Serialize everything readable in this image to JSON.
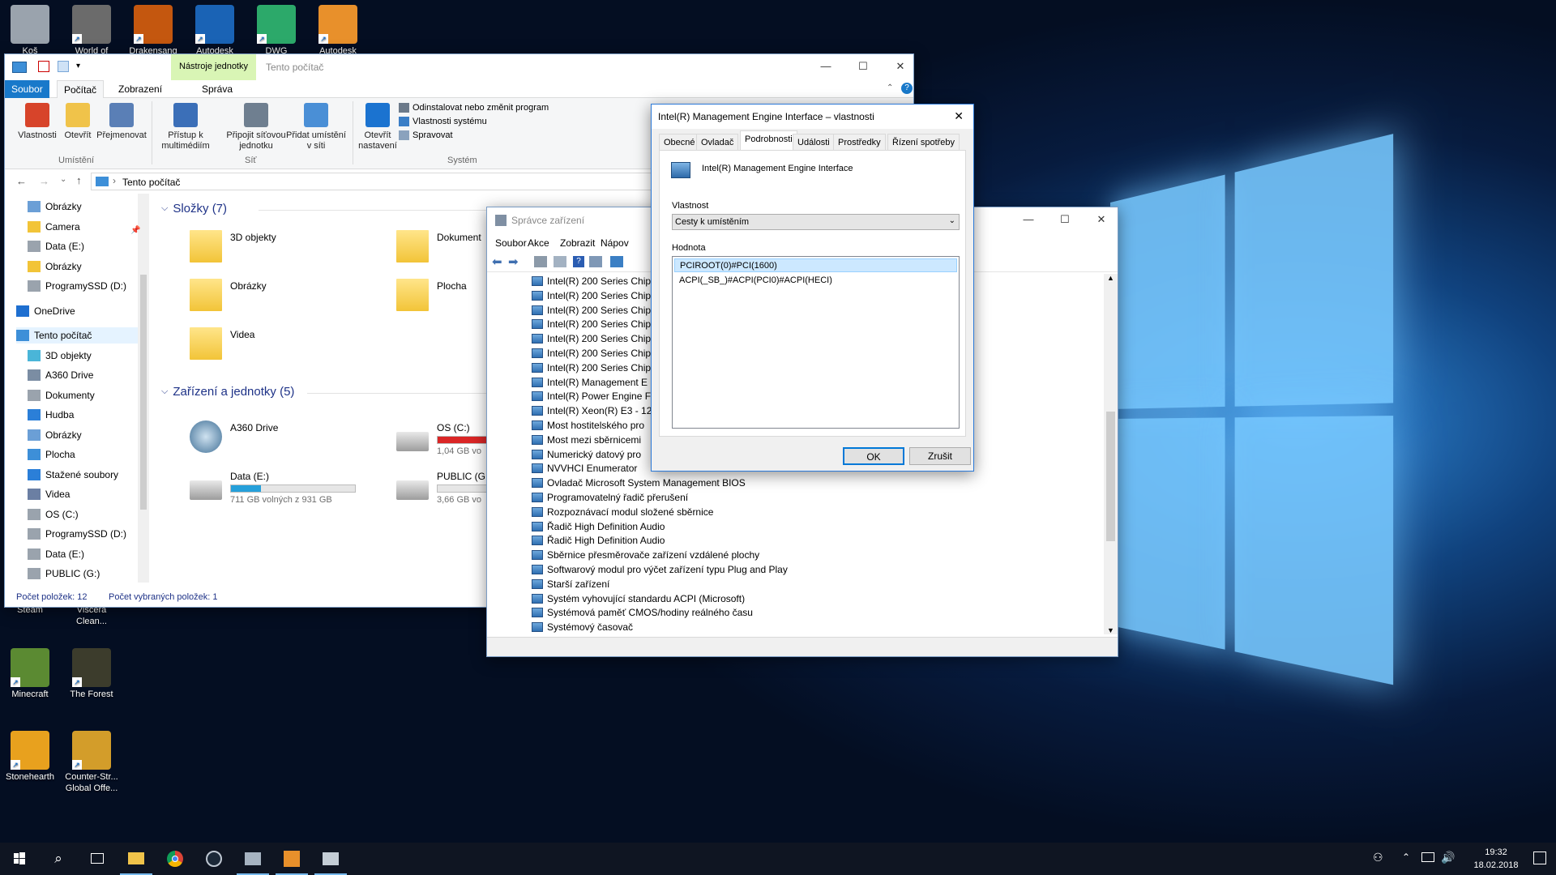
{
  "desktop": {
    "icons": [
      {
        "label": "Koš",
        "color": "#9aa3ad"
      },
      {
        "label": "World of",
        "color": "#6b6b6b"
      },
      {
        "label": "Drakensang",
        "color": "#c4570f"
      },
      {
        "label": "Autodesk",
        "color": "#1a63b5"
      },
      {
        "label": "DWG",
        "color": "#2ca96a"
      },
      {
        "label": "Autodesk",
        "color": "#e8902b"
      },
      {
        "label": "Steam",
        "color": "#1b2838"
      },
      {
        "label": "Viscera Clean...",
        "color": "#b44c2a"
      },
      {
        "label": "Minecraft",
        "color": "#5b8a32"
      },
      {
        "label": "The Forest",
        "color": "#3c3c2c"
      },
      {
        "label": "Stonehearth",
        "color": "#e8a11e"
      },
      {
        "label": "Counter-Str... Global Offe...",
        "color": "#d39d2a"
      }
    ]
  },
  "explorer": {
    "qat_labels": [
      "Soubor",
      "Počítač",
      "Zobrazení"
    ],
    "context_tab": "Nástroje jednotky",
    "context_sub": "Správa",
    "title": "Tento počítač",
    "ribbon": {
      "items": [
        "Vlastnosti",
        "Otevřít",
        "Přejmenovat",
        "Přístup k multimédiím",
        "Připojit síťovou jednotku",
        "Přidat umístění v síti",
        "Otevřít nastavení"
      ],
      "small": [
        "Odinstalovat nebo změnit program",
        "Vlastnosti systému",
        "Spravovat"
      ],
      "groups": [
        "Umístění",
        "Síť",
        "Systém"
      ]
    },
    "address": "Tento počítač",
    "nav": [
      "Obrázky",
      "Camera",
      "Data (E:)",
      "Obrázky",
      "ProgramySSD (D:)",
      "OneDrive",
      "Tento počítač",
      "3D objekty",
      "A360 Drive",
      "Dokumenty",
      "Hudba",
      "Obrázky",
      "Plocha",
      "Stažené soubory",
      "Videa",
      "OS (C:)",
      "ProgramySSD (D:)",
      "Data (E:)",
      "PUBLIC (G:)"
    ],
    "folders_header": "Složky (7)",
    "folders": [
      "3D objekty",
      "Dokument",
      "Obrázky",
      "Plocha",
      "Videa"
    ],
    "devices_header": "Zařízení a jednotky (5)",
    "drives": [
      {
        "name": "A360 Drive",
        "free": "",
        "fill": 0
      },
      {
        "name": "OS (C:)",
        "free": "1,04 GB vo",
        "fill": 0.95
      },
      {
        "name": "Data (E:)",
        "free": "711 GB volných z 931 GB",
        "fill": 0.24
      },
      {
        "name": "PUBLIC (G",
        "free": "3,66 GB vo",
        "fill": 0
      }
    ],
    "status_count": "Počet položek: 12",
    "status_selected": "Počet vybraných položek: 1",
    "colors": {
      "accent": "#1979ca",
      "context": "#d9f5b5",
      "capacity_ok": "#26a0da",
      "capacity_low": "#da2626"
    }
  },
  "devmgr": {
    "title": "Správce zařízení",
    "menu": [
      "Soubor",
      "Akce",
      "Zobrazit",
      "Nápov"
    ],
    "devices": [
      "Intel(R) 200 Series Chip",
      "Intel(R) 200 Series Chip",
      "Intel(R) 200 Series Chip",
      "Intel(R) 200 Series Chip",
      "Intel(R) 200 Series Chip",
      "Intel(R) 200 Series Chip",
      "Intel(R) 200 Series Chip",
      "Intel(R) Management E",
      "Intel(R) Power Engine F",
      "Intel(R) Xeon(R) E3 - 12",
      "Most hostitelského pro",
      "Most mezi sběrnicemi",
      "Numerický datový pro",
      "NVVHCI Enumerator",
      "Ovladač Microsoft System Management BIOS",
      "Programovatelný řadič přerušení",
      "Rozpoznávací modul složené sběrnice",
      "Řadič High Definition Audio",
      "Řadič High Definition Audio",
      "Sběrnice přesměrovače zařízení vzdálené plochy",
      "Softwarový modul pro výčet zařízení typu Plug and Play",
      "Starší zařízení",
      "Systém vyhovující standardu ACPI (Microsoft)",
      "Systémová paměť CMOS/hodiny reálného času",
      "Systémový časovač"
    ]
  },
  "dialog": {
    "title": "Intel(R) Management Engine Interface – vlastnosti",
    "tabs": [
      "Obecné",
      "Ovladač",
      "Podrobnosti",
      "Události",
      "Prostředky",
      "Řízení spotřeby"
    ],
    "device_name": "Intel(R) Management Engine Interface",
    "property_label": "Vlastnost",
    "property_value": "Cesty k umístěním",
    "value_label": "Hodnota",
    "values": [
      "PCIROOT(0)#PCI(1600)",
      "ACPI(_SB_)#ACPI(PCI0)#ACPI(HECI)"
    ],
    "ok": "OK",
    "cancel": "Zrušit"
  },
  "taskbar": {
    "time": "19:32",
    "date": "18.02.2018"
  }
}
